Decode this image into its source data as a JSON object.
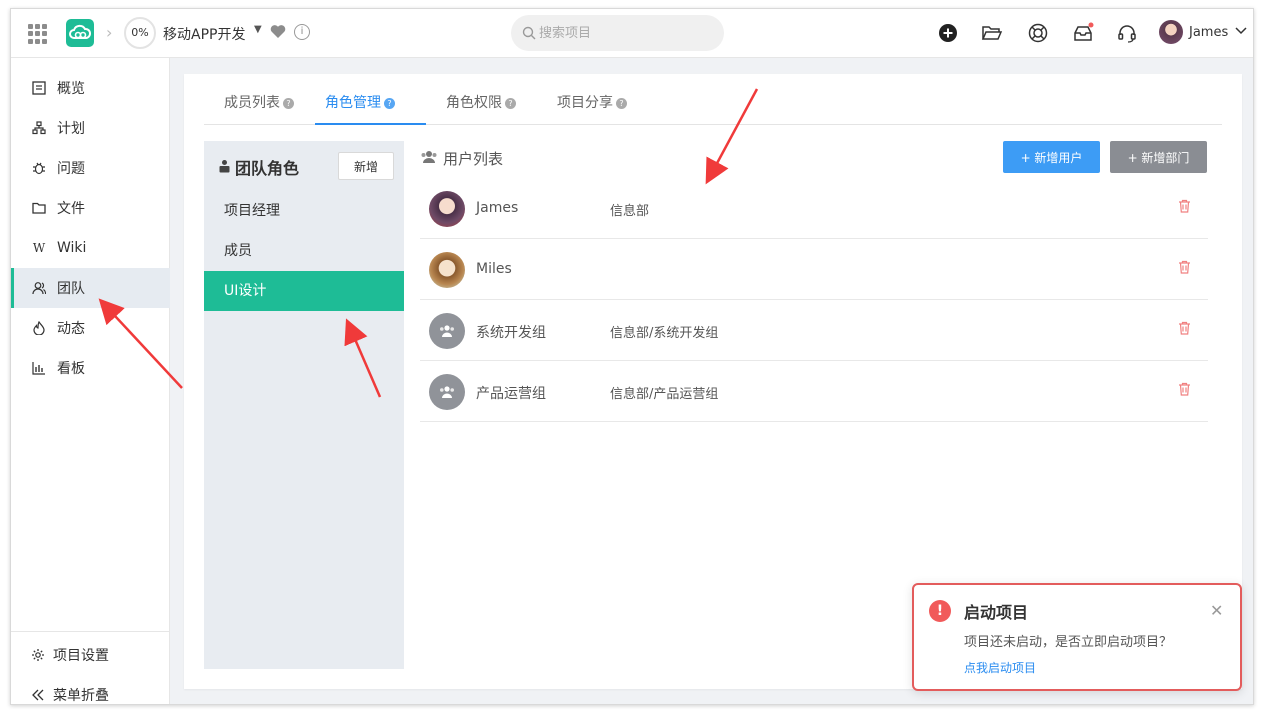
{
  "topbar": {
    "progress": "0%",
    "project_name": "移动APP开发",
    "search_placeholder": "搜索项目",
    "user_name": "James"
  },
  "sidebar": {
    "items": [
      {
        "label": "概览",
        "icon": "overview-icon"
      },
      {
        "label": "计划",
        "icon": "plan-icon"
      },
      {
        "label": "问题",
        "icon": "bug-icon"
      },
      {
        "label": "文件",
        "icon": "folder-icon"
      },
      {
        "label": "Wiki",
        "icon": "wiki-icon"
      },
      {
        "label": "团队",
        "icon": "team-icon",
        "active": true
      },
      {
        "label": "动态",
        "icon": "activity-icon"
      },
      {
        "label": "看板",
        "icon": "board-icon"
      }
    ],
    "settings_label": "项目设置",
    "collapse_label": "菜单折叠"
  },
  "tabs": [
    {
      "label": "成员列表"
    },
    {
      "label": "角色管理",
      "active": true
    },
    {
      "label": "角色权限"
    },
    {
      "label": "项目分享"
    }
  ],
  "roles": {
    "title": "团队角色",
    "add_label": "新增",
    "items": [
      "项目经理",
      "成员",
      "UI设计"
    ],
    "active_index": 2
  },
  "user_list": {
    "title": "用户列表",
    "add_user_label": "+ 新增用户",
    "add_dept_label": "+ 新增部门",
    "rows": [
      {
        "name": "James",
        "dept": "信息部",
        "type": "user"
      },
      {
        "name": "Miles",
        "dept": "",
        "type": "user"
      },
      {
        "name": "系统开发组",
        "dept": "信息部/系统开发组",
        "type": "group"
      },
      {
        "name": "产品运营组",
        "dept": "信息部/产品运营组",
        "type": "group"
      }
    ]
  },
  "notification": {
    "title": "启动项目",
    "message": "项目还未启动，是否立即启动项目？",
    "link": "点我启动项目"
  },
  "colors": {
    "accent_green": "#1ebc96",
    "primary_blue": "#3d9cf5",
    "danger_red": "#f15a5a"
  }
}
